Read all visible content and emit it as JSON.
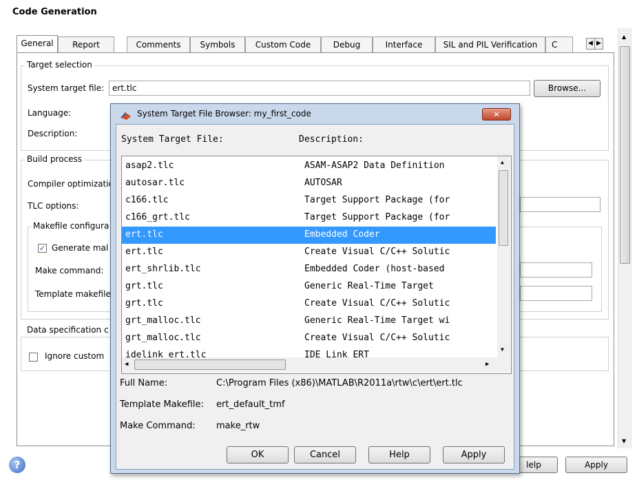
{
  "window": {
    "title": "Code Generation",
    "help_icon": "question-icon"
  },
  "tabs": [
    "General",
    "Report",
    "Comments",
    "Symbols",
    "Custom Code",
    "Debug",
    "Interface",
    "SIL and PIL Verification",
    "C"
  ],
  "target_selection": {
    "group_title": "Target selection",
    "system_target_label": "System target file:",
    "system_target_value": "ert.tlc",
    "browse_label": "Browse...",
    "language_label": "Language:",
    "description_label": "Description:"
  },
  "build_process": {
    "group_title": "Build process",
    "compiler_label": "Compiler optimizatio",
    "tlc_label": "TLC options:",
    "makefile_group": "Makefile configura",
    "generate_makefile_label": "Generate mal",
    "generate_makefile_checked": true,
    "make_command_label": "Make command:",
    "template_label": "Template makefile"
  },
  "data_spec": {
    "group_title": "Data specification c",
    "ignore_custom_label": "Ignore custom",
    "ignore_custom_checked": false
  },
  "bottom_buttons": {
    "help_partial": "lelp",
    "apply": "Apply"
  },
  "dialog": {
    "title": "System Target File Browser: my_first_code",
    "close_label": "✕",
    "col1": "System Target File:",
    "col2": "Description:",
    "rows": [
      {
        "file": "asap2.tlc",
        "desc": "ASAM-ASAP2 Data Definition",
        "selected": false
      },
      {
        "file": "autosar.tlc",
        "desc": "AUTOSAR",
        "selected": false
      },
      {
        "file": "c166.tlc",
        "desc": "Target Support Package (for",
        "selected": false
      },
      {
        "file": "c166_grt.tlc",
        "desc": "Target Support Package (for",
        "selected": false
      },
      {
        "file": "ert.tlc",
        "desc": "Embedded Coder",
        "selected": true
      },
      {
        "file": "ert.tlc",
        "desc": "Create Visual C/C++ Solutic",
        "selected": false
      },
      {
        "file": "ert_shrlib.tlc",
        "desc": "Embedded Coder (host-based",
        "selected": false
      },
      {
        "file": "grt.tlc",
        "desc": "Generic Real-Time Target",
        "selected": false
      },
      {
        "file": "grt.tlc",
        "desc": "Create Visual C/C++ Solutic",
        "selected": false
      },
      {
        "file": "grt_malloc.tlc",
        "desc": "Generic Real-Time Target wi",
        "selected": false
      },
      {
        "file": "grt_malloc.tlc",
        "desc": "Create Visual C/C++ Solutic",
        "selected": false
      },
      {
        "file": "idelink_ert.tlc",
        "desc": "IDE Link ERT",
        "selected": false
      }
    ],
    "full_name_label": "Full Name:",
    "full_name_value": "C:\\Program Files (x86)\\MATLAB\\R2011a\\rtw\\c\\ert\\ert.tlc",
    "template_label": "Template Makefile:",
    "template_value": "ert_default_tmf",
    "make_label": "Make Command:",
    "make_value": "make_rtw",
    "buttons": {
      "ok": "OK",
      "cancel": "Cancel",
      "help": "Help",
      "apply": "Apply"
    }
  },
  "colors": {
    "selection": "#3399ff",
    "dialog_frame": "#c9d8ea"
  }
}
